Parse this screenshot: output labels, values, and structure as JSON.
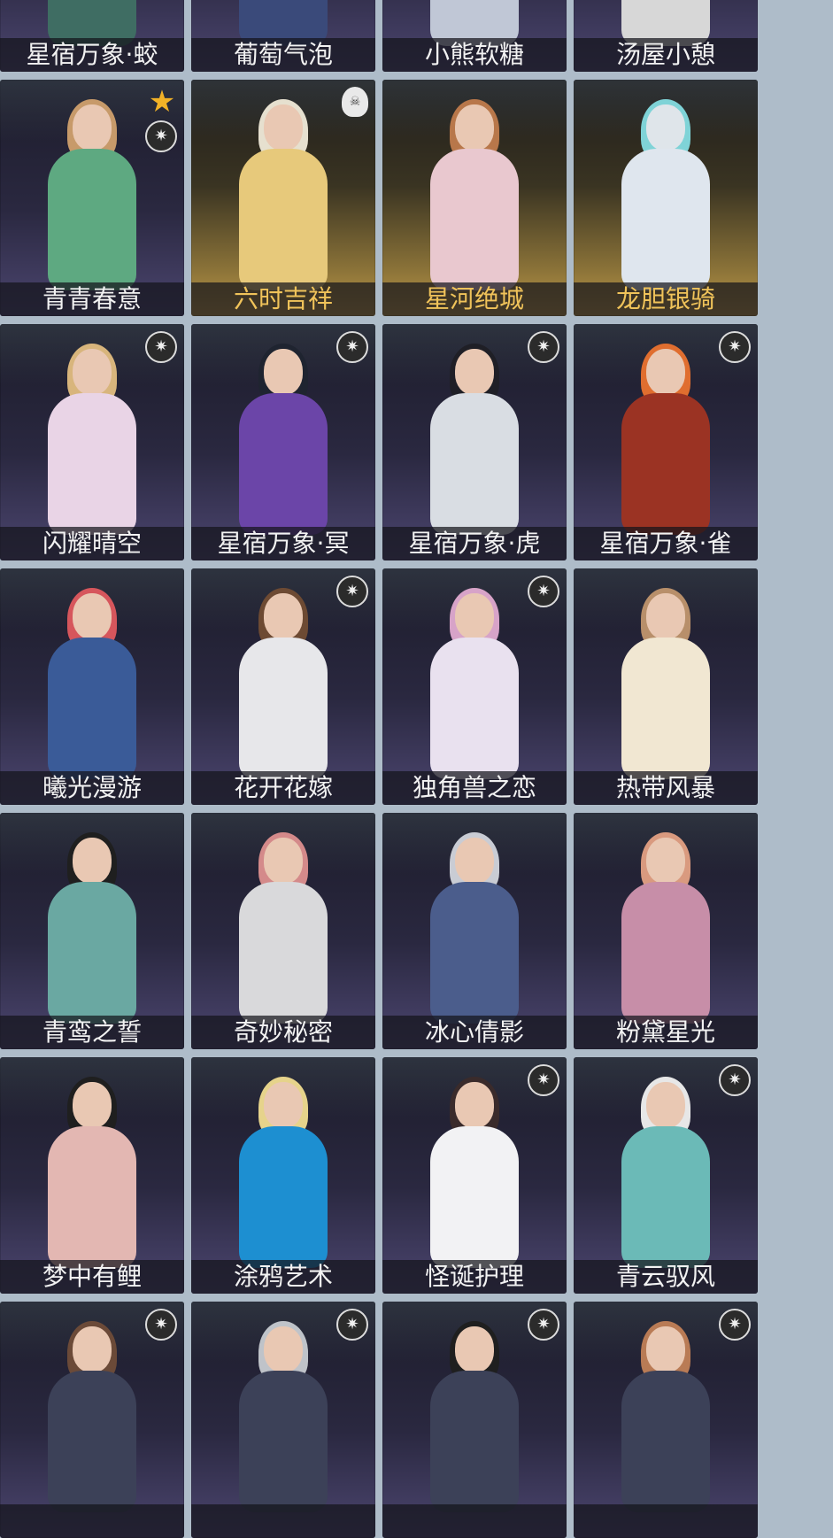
{
  "cards": [
    {
      "name": "星宿万象·蛟"
    },
    {
      "name": "葡萄气泡"
    },
    {
      "name": "小熊软糖"
    },
    {
      "name": "汤屋小憩"
    },
    {
      "name": "青青春意"
    },
    {
      "name": "六时吉祥"
    },
    {
      "name": "星河绝城"
    },
    {
      "name": "龙胆银骑"
    },
    {
      "name": "闪耀晴空"
    },
    {
      "name": "星宿万象·冥"
    },
    {
      "name": "星宿万象·虎"
    },
    {
      "name": "星宿万象·雀"
    },
    {
      "name": "曦光漫游"
    },
    {
      "name": "花开花嫁"
    },
    {
      "name": "独角兽之恋"
    },
    {
      "name": "热带风暴"
    },
    {
      "name": "青鸾之誓"
    },
    {
      "name": "奇妙秘密"
    },
    {
      "name": "冰心倩影"
    },
    {
      "name": "粉黛星光"
    },
    {
      "name": "梦中有鲤"
    },
    {
      "name": "涂鸦艺术"
    },
    {
      "name": "怪诞护理"
    },
    {
      "name": "青云驭风"
    },
    {
      "name": ""
    },
    {
      "name": ""
    },
    {
      "name": ""
    },
    {
      "name": ""
    }
  ],
  "icons": {
    "star": "★",
    "badge": "✷",
    "skull": "☠"
  },
  "colors": {
    "background": "#aebcc9",
    "label_gold": "#f0c35a"
  }
}
